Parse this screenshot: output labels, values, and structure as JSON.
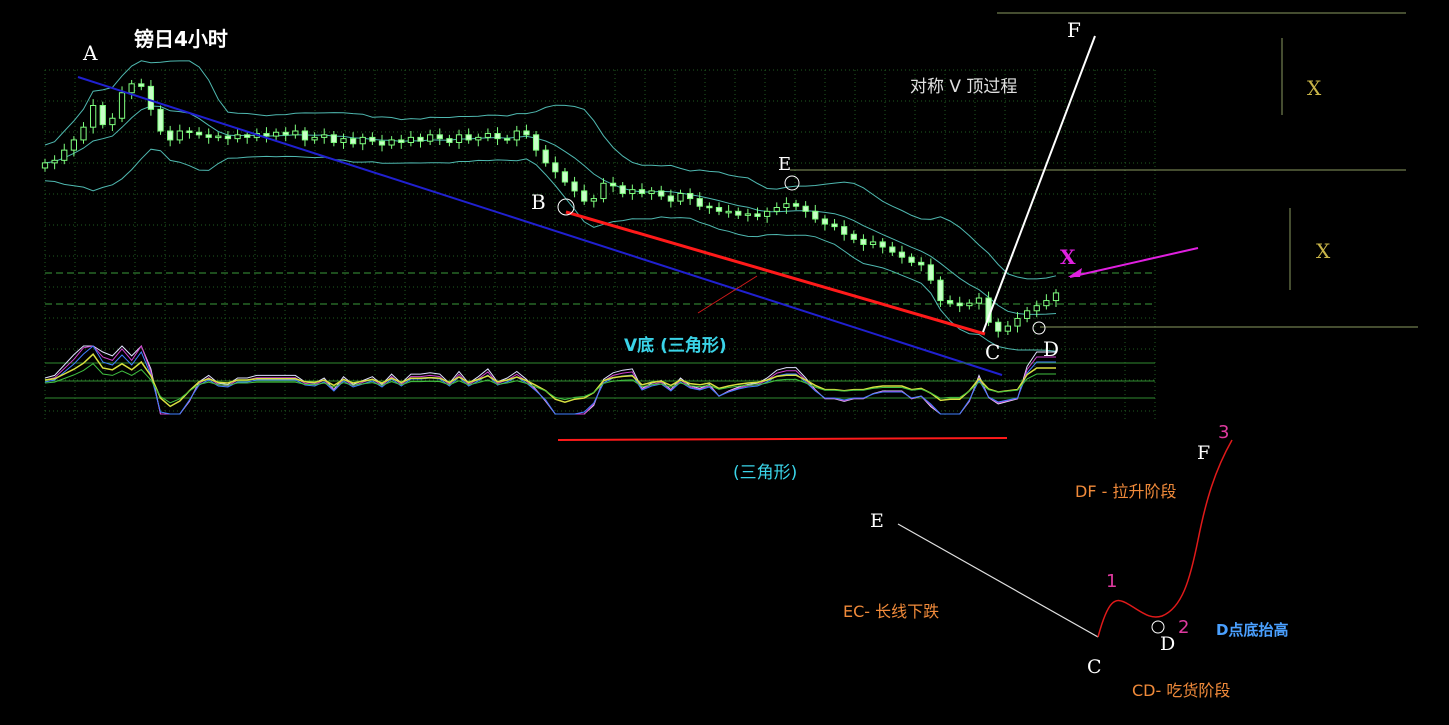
{
  "title": "镑日4小时",
  "colors": {
    "background": "#000000",
    "grid": "#1f5c1f",
    "bollinger": "#4fb8b0",
    "candle": "#7fff7f",
    "trend_blue": "#2020d0",
    "trend_red": "#ff1a1a",
    "white": "#ffffff",
    "magenta": "#e020e0",
    "level_line": "#8a9a60",
    "x_label": "#c8b448",
    "cyan_text": "#3ad4e8",
    "orange_text": "#f08a3a",
    "blue_text": "#4aa0ff",
    "pink_num": "#e03aa0"
  },
  "chart_labels": {
    "A": "A",
    "B": "B",
    "C": "C",
    "D": "D",
    "E": "E",
    "F": "F",
    "x_magenta": "X",
    "x_top": "X",
    "x_mid": "X",
    "process_title": "对称 V 顶过程",
    "v_bottom": "V底 (三角形)",
    "triangle": "(三角形)"
  },
  "schematic": {
    "E": "E",
    "C": "C",
    "D": "D",
    "F": "F",
    "num1": "1",
    "num2": "2",
    "num3": "3",
    "ec": "EC- 长线下跌",
    "cd": "CD- 吃货阶段",
    "df": "DF - 拉升阶段",
    "d_raise": "D点底抬高"
  },
  "chart_data": {
    "type": "candlestick",
    "title": "镑日4小时",
    "grid": true,
    "series": [
      {
        "name": "",
        "values": [
          1300,
          1302,
          1310,
          1318,
          1328,
          1345,
          1330,
          1335,
          1355,
          1362,
          1360,
          1342,
          1325,
          1318,
          1325,
          1324,
          1322,
          1320,
          1321,
          1319,
          1322,
          1320,
          1323,
          1321,
          1324,
          1322,
          1325,
          1318,
          1320,
          1322,
          1316,
          1319,
          1315,
          1320,
          1317,
          1314,
          1318,
          1316,
          1320,
          1317,
          1322,
          1319,
          1316,
          1322,
          1318,
          1320,
          1323,
          1319,
          1318,
          1325,
          1322,
          1310,
          1300,
          1293,
          1285,
          1278,
          1270,
          1272,
          1284,
          1282,
          1276,
          1279,
          1276,
          1278,
          1274,
          1270,
          1276,
          1272,
          1266,
          1265,
          1262,
          1262,
          1259,
          1260,
          1258,
          1262,
          1265,
          1268,
          1266,
          1262,
          1256,
          1252,
          1250,
          1244,
          1240,
          1236,
          1238,
          1234,
          1230,
          1226,
          1222,
          1220,
          1208,
          1192,
          1190,
          1188,
          1190,
          1194,
          1175,
          1168,
          1172,
          1178,
          1184,
          1188,
          1192,
          1198
        ]
      }
    ]
  }
}
